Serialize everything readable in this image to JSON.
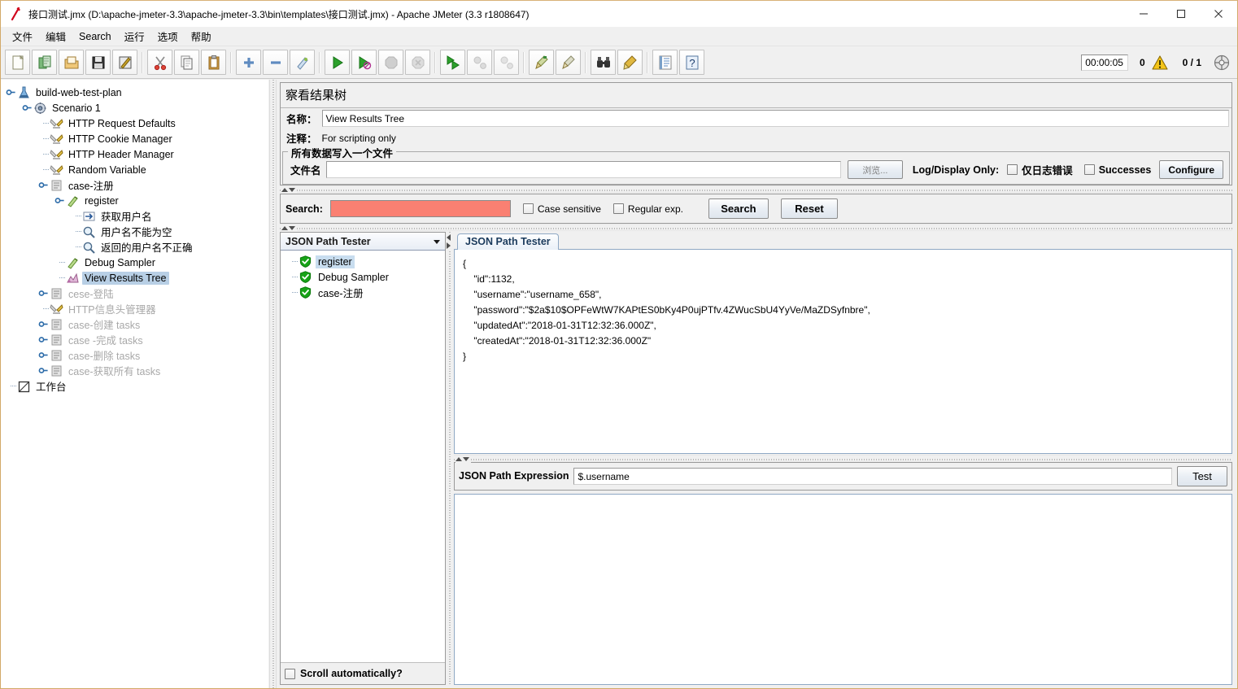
{
  "window": {
    "title": "接口测试.jmx (D:\\apache-jmeter-3.3\\apache-jmeter-3.3\\bin\\templates\\接口测试.jmx) - Apache JMeter (3.3 r1808647)",
    "app_icon": "jmeter-feather-icon",
    "minimize": "–",
    "maximize": "▢",
    "close": "✕"
  },
  "menu": {
    "items": [
      {
        "label": "文件",
        "name": "menu-file"
      },
      {
        "label": "编辑",
        "name": "menu-edit"
      },
      {
        "label": "Search",
        "name": "menu-search"
      },
      {
        "label": "运行",
        "name": "menu-run"
      },
      {
        "label": "选项",
        "name": "menu-options"
      },
      {
        "label": "帮助",
        "name": "menu-help"
      }
    ]
  },
  "toolbar": {
    "buttons": [
      {
        "name": "new-button",
        "icon": "new-document-icon"
      },
      {
        "name": "templates-button",
        "icon": "templates-icon"
      },
      {
        "name": "open-button",
        "icon": "open-folder-icon"
      },
      {
        "name": "save-button",
        "icon": "floppy-disk-icon"
      },
      {
        "name": "save-as-button",
        "icon": "save-as-icon"
      },
      {
        "name": "cut-button",
        "icon": "scissors-icon"
      },
      {
        "name": "copy-button",
        "icon": "copy-pages-icon"
      },
      {
        "name": "paste-button",
        "icon": "clipboard-icon"
      },
      {
        "name": "expand-all-button",
        "icon": "plus-icon"
      },
      {
        "name": "collapse-all-button",
        "icon": "minus-icon"
      },
      {
        "name": "toggle-button",
        "icon": "toggle-icon"
      },
      {
        "name": "start-button",
        "icon": "play-green-icon"
      },
      {
        "name": "start-no-pauses-button",
        "icon": "play-no-pause-icon"
      },
      {
        "name": "stop-button",
        "icon": "stop-octagon-icon"
      },
      {
        "name": "shutdown-button",
        "icon": "shutdown-icon"
      },
      {
        "name": "start-remote-button",
        "icon": "remote-start-icon"
      },
      {
        "name": "stop-remote-button",
        "icon": "remote-stop-icon"
      },
      {
        "name": "shutdown-remote-button",
        "icon": "remote-shutdown-icon"
      },
      {
        "name": "clear-button",
        "icon": "broom-clear-icon"
      },
      {
        "name": "clear-all-button",
        "icon": "broom-clear-all-icon"
      },
      {
        "name": "search-button",
        "icon": "binoculars-icon"
      },
      {
        "name": "search-reset-button",
        "icon": "brush-reset-icon"
      },
      {
        "name": "function-helper-button",
        "icon": "function-helper-icon"
      },
      {
        "name": "help-button",
        "icon": "help-question-icon"
      }
    ],
    "timer": "00:00:05",
    "error_count": "0",
    "warning_icon": "warning-triangle-icon",
    "thread_count": "0 / 1",
    "remote_icon": "connections-sphere-icon"
  },
  "tree": {
    "nodes": [
      {
        "label": "build-web-test-plan",
        "icon": "test-plan-icon",
        "depth": 0,
        "selected": false,
        "disabled": false,
        "knob": "expanded"
      },
      {
        "label": "Scenario 1",
        "icon": "thread-group-icon",
        "depth": 1,
        "selected": false,
        "disabled": false,
        "knob": "expanded"
      },
      {
        "label": "HTTP Request Defaults",
        "icon": "config-wrench-icon",
        "depth": 2,
        "selected": false,
        "disabled": false,
        "knob": "leaf"
      },
      {
        "label": "HTTP Cookie Manager",
        "icon": "config-wrench-icon",
        "depth": 2,
        "selected": false,
        "disabled": false,
        "knob": "leaf"
      },
      {
        "label": "HTTP Header Manager",
        "icon": "config-wrench-icon",
        "depth": 2,
        "selected": false,
        "disabled": false,
        "knob": "leaf"
      },
      {
        "label": "Random Variable",
        "icon": "config-wrench-icon",
        "depth": 2,
        "selected": false,
        "disabled": false,
        "knob": "leaf"
      },
      {
        "label": "case-注册",
        "icon": "transaction-controller-icon",
        "depth": 2,
        "selected": false,
        "disabled": false,
        "knob": "expanded"
      },
      {
        "label": "register",
        "icon": "http-sampler-icon",
        "depth": 3,
        "selected": false,
        "disabled": false,
        "knob": "expanded"
      },
      {
        "label": "获取用户名",
        "icon": "post-processor-icon",
        "depth": 4,
        "selected": false,
        "disabled": false,
        "knob": "leaf"
      },
      {
        "label": "用户名不能为空",
        "icon": "assertion-icon",
        "depth": 4,
        "selected": false,
        "disabled": false,
        "knob": "leaf"
      },
      {
        "label": "返回的用户名不正确",
        "icon": "assertion-icon",
        "depth": 4,
        "selected": false,
        "disabled": false,
        "knob": "leaf"
      },
      {
        "label": "Debug Sampler",
        "icon": "http-sampler-icon",
        "depth": 3,
        "selected": false,
        "disabled": false,
        "knob": "leaf"
      },
      {
        "label": "View Results Tree",
        "icon": "view-results-tree-icon",
        "depth": 3,
        "selected": true,
        "disabled": false,
        "knob": "leaf"
      },
      {
        "label": "cese-登陆",
        "icon": "transaction-controller-icon",
        "depth": 2,
        "selected": false,
        "disabled": true,
        "knob": "collapsed"
      },
      {
        "label": "HTTP信息头管理器",
        "icon": "config-wrench-icon",
        "depth": 2,
        "selected": false,
        "disabled": true,
        "knob": "leaf"
      },
      {
        "label": "case-创建 tasks",
        "icon": "transaction-controller-icon",
        "depth": 2,
        "selected": false,
        "disabled": true,
        "knob": "collapsed"
      },
      {
        "label": "case -完成 tasks",
        "icon": "transaction-controller-icon",
        "depth": 2,
        "selected": false,
        "disabled": true,
        "knob": "collapsed"
      },
      {
        "label": "case-删除 tasks",
        "icon": "transaction-controller-icon",
        "depth": 2,
        "selected": false,
        "disabled": true,
        "knob": "collapsed"
      },
      {
        "label": "case-获取所有 tasks",
        "icon": "transaction-controller-icon",
        "depth": 2,
        "selected": false,
        "disabled": true,
        "knob": "collapsed"
      },
      {
        "label": "工作台",
        "icon": "workbench-icon",
        "depth": 0,
        "selected": false,
        "disabled": false,
        "knob": "leaf"
      }
    ]
  },
  "panel": {
    "title": "察看结果树",
    "name_label": "名称：",
    "name_value": "View Results Tree",
    "comment_label": "注释：",
    "comment_value": "For scripting only",
    "file_group_legend": "所有数据写入一个文件",
    "filename_label": "文件名",
    "filename_value": "",
    "browse_button": "浏览...",
    "log_display_label": "Log/Display Only:",
    "errors_only_label": "仅日志错误",
    "errors_only_checked": false,
    "successes_label": "Successes",
    "successes_checked": false,
    "configure_button": "Configure"
  },
  "search": {
    "label": "Search:",
    "value": "",
    "field_color": "#fa8072",
    "case_sensitive_label": "Case sensitive",
    "case_sensitive_checked": false,
    "regex_label": "Regular exp.",
    "regex_checked": false,
    "search_button": "Search",
    "reset_button": "Reset"
  },
  "results": {
    "renderer_selected": "JSON Path Tester",
    "items": [
      {
        "label": "register",
        "icon": "success-check-icon",
        "selected": true
      },
      {
        "label": "Debug Sampler",
        "icon": "success-check-icon",
        "selected": false
      },
      {
        "label": "case-注册",
        "icon": "success-check-icon",
        "selected": false
      }
    ],
    "scroll_automatically_label": "Scroll automatically?",
    "scroll_automatically_checked": false
  },
  "detail": {
    "tab_label": "JSON Path Tester",
    "json_body": "{\n    \"id\":1132,\n    \"username\":\"username_658\",\n    \"password\":\"$2a$10$OPFeWtW7KAPtES0bKy4P0ujPTfv.4ZWucSbU4YyVe/MaZDSyfnbre\",\n    \"updatedAt\":\"2018-01-31T12:32:36.000Z\",\n    \"createdAt\":\"2018-01-31T12:32:36.000Z\"\n}",
    "expression_label": "JSON Path Expression",
    "expression_value": "$.username",
    "test_button": "Test",
    "result_value": ""
  },
  "colors": {
    "window_border": "#d2a968",
    "selection": "#b8cfe5",
    "search_highlight": "#fa8072",
    "success_green": "#17a317",
    "tab_text": "#1a3a5c"
  }
}
